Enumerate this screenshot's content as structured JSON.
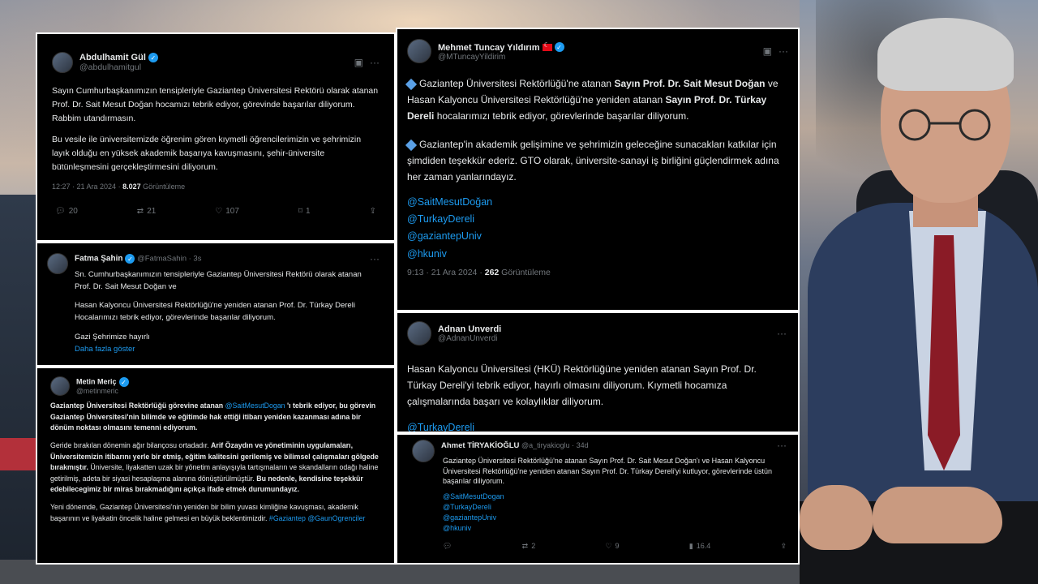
{
  "tweets": {
    "abdulhamit": {
      "name": "Abdulhamit Gül",
      "handle": "@abdulhamitgul",
      "paragraphs": [
        "Sayın Cumhurbaşkanımızın tensipleriyle Gaziantep Üniversitesi Rektörü olarak atanan Prof. Dr. Sait Mesut Doğan hocamızı tebrik ediyor, görevinde başarılar diliyorum. Rabbim utandırmasın.",
        "Bu vesile ile üniversitemizde öğrenim gören kıymetli öğrencilerimizin ve şehrimizin layık olduğu en yüksek akademik başarıya kavuşmasını, şehir-üniversite bütünleşmesini gerçekleştirmesini diliyorum."
      ],
      "time": "12:27 · 21 Ara 2024 · ",
      "views": "8.027",
      "views_label": " Görüntüleme",
      "replies": "20",
      "reposts": "21",
      "likes": "107",
      "bookmarks": "1"
    },
    "fatma": {
      "name": "Fatma Şahin",
      "handle": "@FatmaSahin · 3s",
      "paragraphs": [
        "Sn. Cumhurbaşkanımızın tensipleriyle Gaziantep Üniversitesi Rektörü olarak atanan Prof. Dr. Sait Mesut Doğan ve",
        "Hasan Kalyoncu Üniversitesi Rektörlüğü'ne yeniden atanan Prof. Dr. Türkay Dereli Hocalarımızı tebrik ediyor, görevlerinde başarılar diliyorum.",
        "Gazi Şehrimize hayırlı"
      ],
      "show_more": "Daha fazla göster"
    },
    "metin": {
      "name": "Metin Meriç",
      "handle": "@metinmeric",
      "p1_pre": "Gaziantep Üniversitesi Rektörlüğü görevine atanan ",
      "p1_mention": "@SaitMesutDogan",
      "p1_post": " 'ı tebrik ediyor, bu görevin Gaziantep Üniversitesi'nin bilimde ve eğitimde hak ettiği itibarı yeniden kazanması adına bir dönüm noktası olmasını temenni ediyorum.",
      "p2_pre": "Geride bırakılan dönemin ağır bilançosu ortadadır. ",
      "p2_bold": "Arif Özaydın ve yönetiminin uygulamaları, Üniversitemizin itibarını yerle bir etmiş, eğitim kalitesini gerilemiş ve bilimsel çalışmaları gölgede bırakmıştır.",
      "p2_mid": " Üniversite, liyakatten uzak bir yönetim anlayışıyla tartışmaların ve skandalların odağı haline getirilmiş, adeta bir siyasi hesaplaşma alanına dönüştürülmüştür. ",
      "p2_bold2": "Bu nedenle, kendisine teşekkür edebilecegimiz bir miras bırakmadığını açıkça ifade etmek durumundayız.",
      "p3": "Yeni dönemde, Gaziantep Üniversitesi'nin yeniden bir bilim yuvası kimliğine kavuşması, akademik başarının ve liyakatin öncelik haline gelmesi en büyük beklentimizdir. ",
      "p3_tags": "#Gaziantep @GaunOgrenciler"
    },
    "mehmet": {
      "name": "Mehmet Tuncay Yıldırım",
      "handle": "@MTuncayYildirim",
      "p1_pre": "Gaziantep Üniversitesi Rektörlüğü'ne atanan ",
      "p1_bold1": "Sayın Prof. Dr. Sait Mesut Doğan",
      "p1_mid": " ve Hasan Kalyoncu Üniversitesi Rektörlüğü'ne yeniden atanan ",
      "p1_bold2": "Sayın Prof. Dr. Türkay Dereli",
      "p1_post": " hocalarımızı tebrik ediyor, görevlerinde başarılar diliyorum.",
      "p2": "Gaziantep'in akademik gelişimine ve şehrimizin geleceğine sunacakları katkılar için şimdiden teşekkür ederiz. GTO olarak, üniversite-sanayi iş birliğini güçlendirmek adına her zaman yanlarındayız.",
      "mentions": [
        "@SaitMesutDoğan",
        "@TurkayDereli",
        "@gaziantepUniv",
        "@hkuniv"
      ],
      "time": "9:13 · 21 Ara 2024 · ",
      "views": "262",
      "views_label": " Görüntüleme"
    },
    "adnan": {
      "name": "Adnan Unverdi",
      "handle": "@AdnanUnverdi",
      "text": "Hasan Kalyoncu Üniversitesi (HKÜ) Rektörlüğüne yeniden atanan Sayın Prof. Dr. Türkay Dereli'yi tebrik ediyor, hayırlı olmasını diliyorum. Kıymetli hocamıza çalışmalarında başarı ve kolaylıklar diliyorum.",
      "mention": "@TurkayDereli"
    },
    "ahmet": {
      "name": "Ahmet TİRYAKİOĞLU",
      "handle": "@a_tiryakioglu · 34d",
      "text": "Gaziantep Üniversitesi Rektörlüğü'ne atanan Sayın Prof. Dr. Sait Mesut Doğan'ı ve Hasan Kalyoncu Üniversitesi Rektörlüğü'ne yeniden atanan Sayın Prof. Dr. Türkay Dereli'yi kutluyor, görevlerinde üstün başarılar diliyorum.",
      "mentions": [
        "@SaitMesutDogan",
        "@TurkayDereli",
        "@gaziantepUniv",
        "@hkuniv"
      ],
      "reposts": "2",
      "likes": "9",
      "views": "16.4"
    }
  },
  "colors": {
    "card_bg": "#000000",
    "text": "#e7e9ea",
    "muted": "#71767b",
    "link": "#1d9bf0",
    "verified": "#1d9bf0"
  }
}
